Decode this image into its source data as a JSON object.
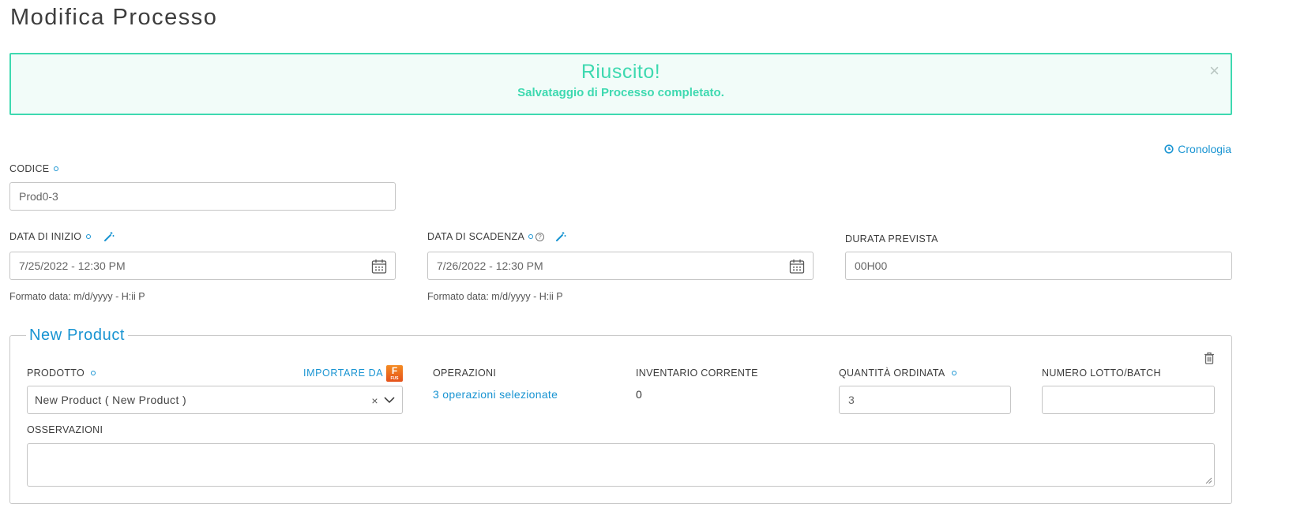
{
  "page": {
    "title": "Modifica Processo"
  },
  "alert": {
    "title": "Riuscito!",
    "message": "Salvataggio di Processo completato.",
    "close": "×",
    "color": "#3ed9b0"
  },
  "history": {
    "label": "Cronologia",
    "icon": "clock-icon"
  },
  "fields": {
    "codice": {
      "label": "CODICE",
      "value": "Prod0-3"
    },
    "data_inizio": {
      "label": "DATA DI INIZIO",
      "value": "7/25/2022 - 12:30 PM",
      "hint": "Formato data: m/d/yyyy - H:ii P"
    },
    "data_scadenza": {
      "label": "DATA DI SCADENZA",
      "value": "7/26/2022 - 12:30 PM",
      "hint": "Formato data: m/d/yyyy - H:ii P",
      "help": "?"
    },
    "durata": {
      "label": "DURATA PREVISTA",
      "value": "00H00"
    }
  },
  "product_section": {
    "legend": "New Product",
    "prodotto": {
      "label": "PRODOTTO",
      "value": "New Product ( New Product )",
      "clear": "×"
    },
    "import": {
      "label": "IMPORTARE DA",
      "badge": "F",
      "badge_sub": "FUS"
    },
    "operazioni": {
      "label": "OPERAZIONI",
      "value": "3 operazioni selezionate"
    },
    "inventario": {
      "label": "INVENTARIO CORRENTE",
      "value": "0"
    },
    "quantita": {
      "label": "QUANTITÀ ORDINATA",
      "value": "3"
    },
    "lotto": {
      "label": "NUMERO LOTTO/BATCH",
      "value": ""
    },
    "osservazioni": {
      "label": "OSSERVAZIONI",
      "value": ""
    }
  },
  "colors": {
    "accent": "#1994d2",
    "success": "#3ed9b0",
    "fusion": "#f48b22"
  }
}
